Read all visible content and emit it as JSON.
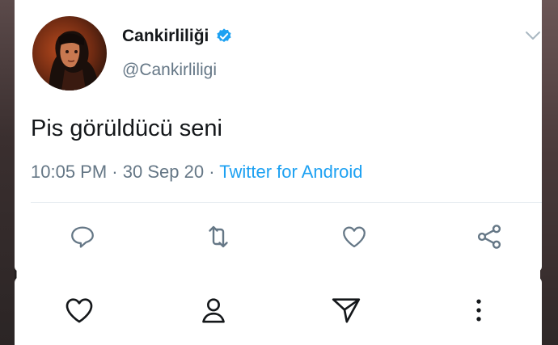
{
  "tweet": {
    "display_name": "Cankirliliği",
    "handle": "@Cankirliligi",
    "text": "Pis görüldücü seni",
    "time": "10:05 PM",
    "date": "30 Sep 20",
    "separator": "·",
    "source": "Twitter for Android",
    "verified": true
  },
  "actions": {
    "reply_icon": "reply-icon",
    "retweet_icon": "retweet-icon",
    "like_icon": "like-icon",
    "share_icon": "share-icon"
  },
  "bottom_bar": {
    "icons": [
      "heart-icon",
      "profile-icon",
      "send-icon",
      "more-icon"
    ]
  },
  "colors": {
    "accent": "#1da1f2",
    "text": "#14171a",
    "muted": "#657786",
    "verified": "#1da1f2"
  }
}
